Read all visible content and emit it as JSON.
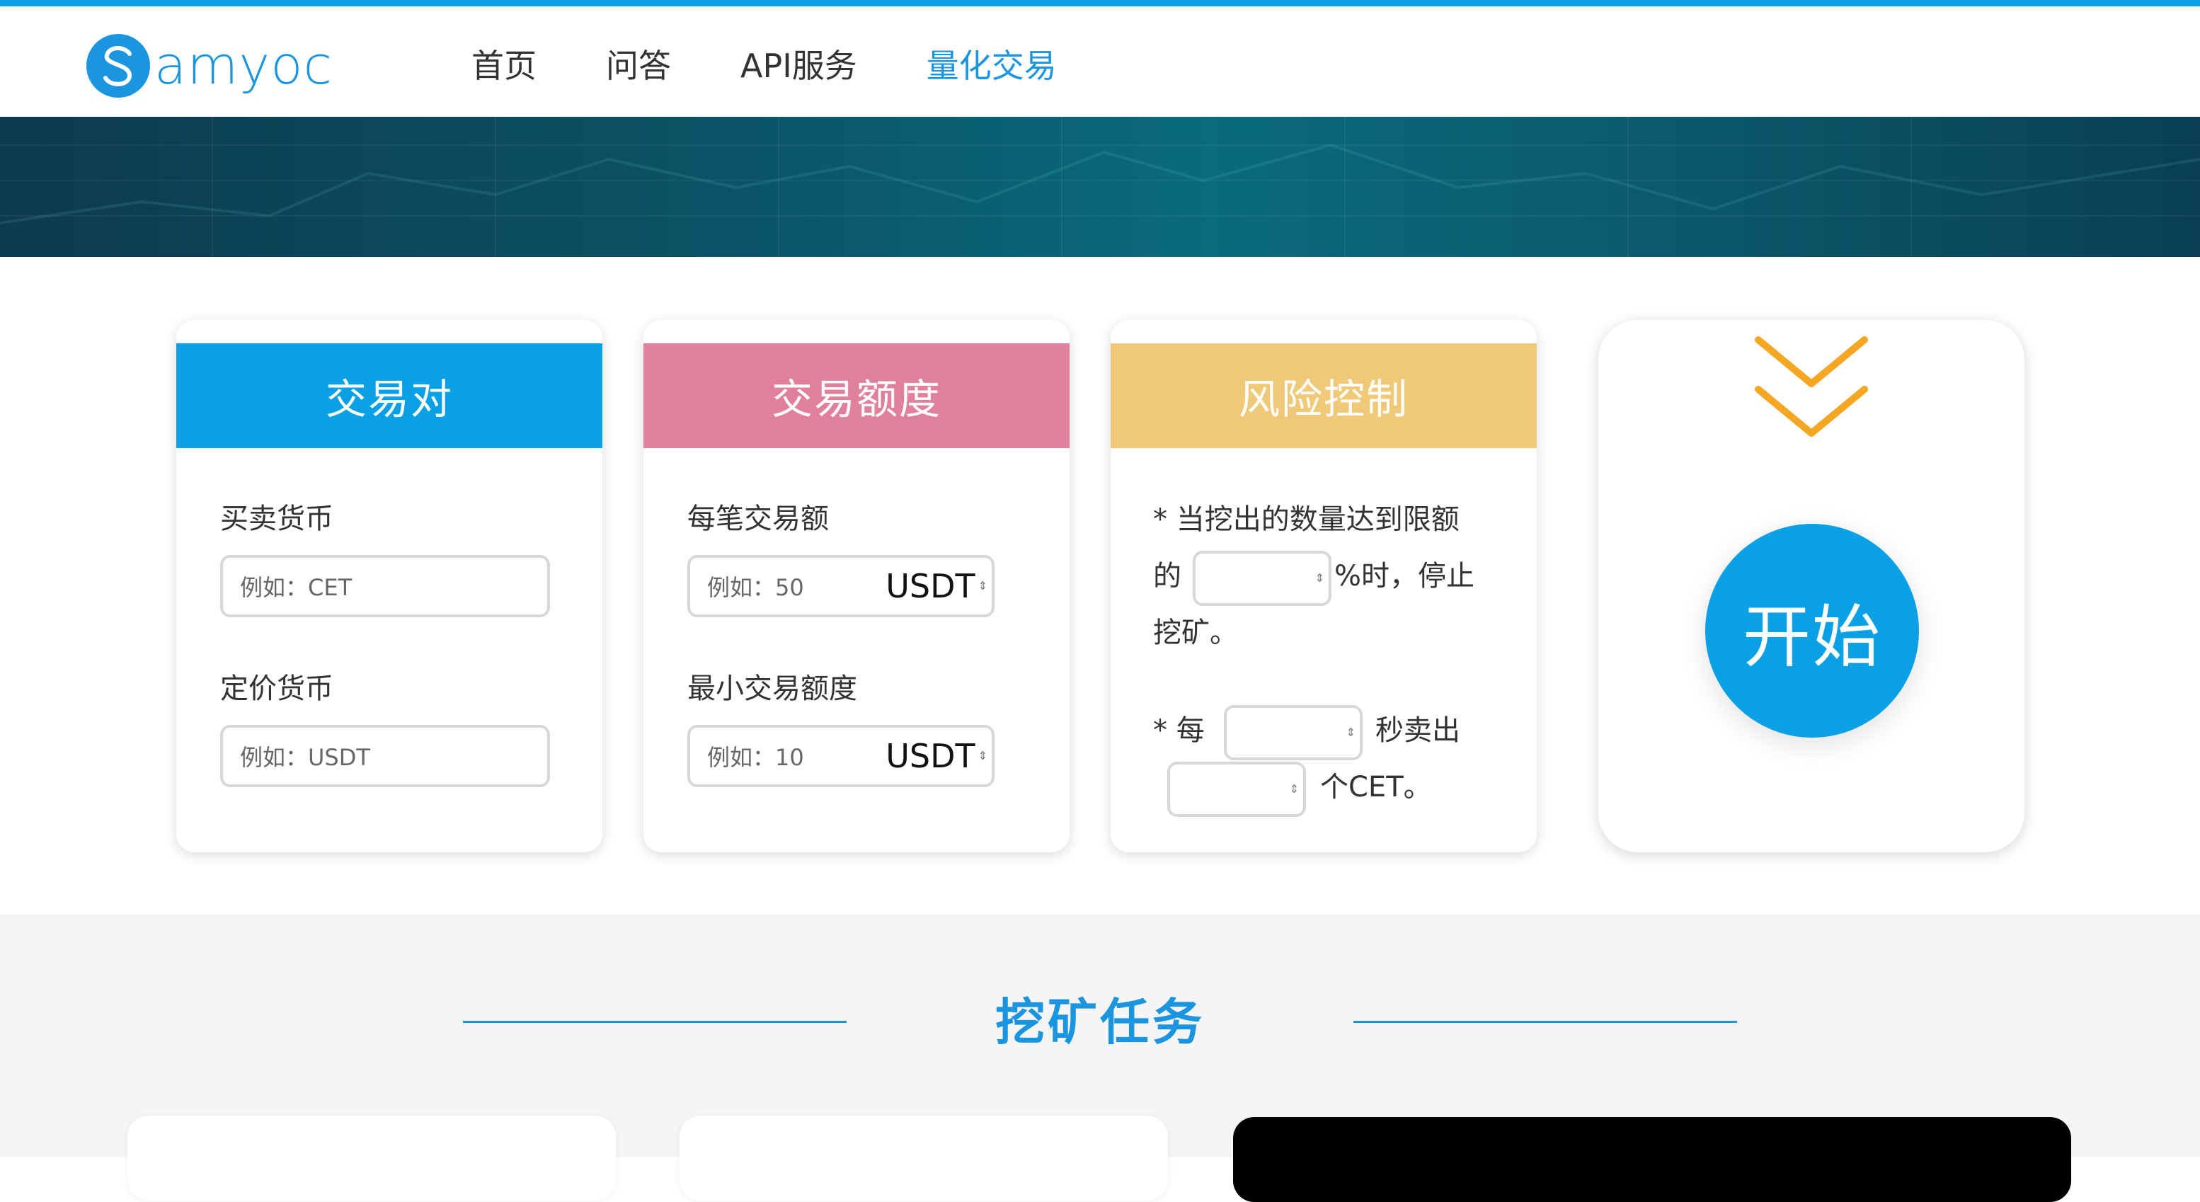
{
  "brand": {
    "name": "amyoc",
    "mark": "S"
  },
  "nav": [
    {
      "label": "首页",
      "active": false
    },
    {
      "label": "问答",
      "active": false
    },
    {
      "label": "API服务",
      "active": false
    },
    {
      "label": "量化交易",
      "active": true
    }
  ],
  "pair_card": {
    "title": "交易对",
    "color": "#0aa0e6",
    "base_label": "买卖货币",
    "base_placeholder": "例如：CET",
    "quote_label": "定价货币",
    "quote_placeholder": "例如：USDT"
  },
  "amount_card": {
    "title": "交易额度",
    "color": "#e0809a",
    "per_trade_label": "每笔交易额",
    "per_trade_placeholder": "例如：50",
    "per_trade_unit": "USDT",
    "min_label": "最小交易额度",
    "min_placeholder": "例如：10",
    "min_unit": "USDT"
  },
  "risk_card": {
    "title": "风险控制",
    "color": "#efc878",
    "rule1_line1": "* 当挖出的数量达到限额",
    "rule1_prefix": "的",
    "rule1_suffix": "%时，停止",
    "rule1_line3": "挖矿。",
    "rule2_prefix": "* 每",
    "rule2_mid": "秒卖出",
    "rule2_suffix": "个CET。"
  },
  "start": {
    "label": "开始",
    "arrow_color": "#f5a623"
  },
  "mining": {
    "title": "挖矿任务"
  }
}
